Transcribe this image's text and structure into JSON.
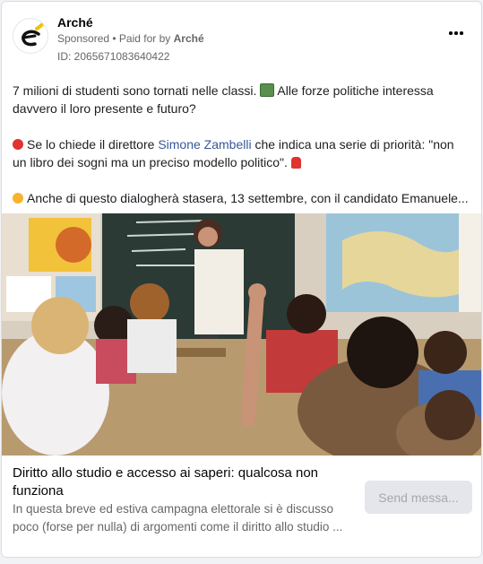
{
  "post": {
    "page_name": "Arché",
    "sponsored": "Sponsored",
    "separator": " • ",
    "paid_for_prefix": "Paid for by ",
    "paid_for_by": "Arché",
    "ad_id": "ID: 2065671083640422",
    "more_icon": "more-options-icon"
  },
  "body": {
    "para1_line1": "7 milioni di studenti sono tornati nelle classi. ",
    "para1_emoji": "classroom-emoji",
    "para1_line1b": " Alle forze politiche interessa",
    "para1_line2": "davvero il loro presente e futuro?",
    "para2_emoji": "red-circle-emoji",
    "para2_pre": "Se lo chiede il direttore ",
    "para2_link": "Simone Zambelli",
    "para2_post": " che indica una serie di priorità: \"non un libro dei sogni ma un preciso modello politico\". ",
    "para2_end_emoji": "backpack-emoji",
    "para3_emoji": "orange-circle-emoji",
    "para3_text": "Anche di questo dialogherà stasera, 13 settembre, con il candidato Emanuele..."
  },
  "link_preview": {
    "headline": "Diritto allo studio e accesso ai saperi: qualcosa non funziona",
    "description_line1": "In questa breve ed estiva campagna elettorale si è discusso",
    "description_line2": "poco (forse per nulla) di argomenti come il diritto allo studio ...",
    "cta_label": "Send messa..."
  },
  "colors": {
    "link": "#385898",
    "muted": "#65676b",
    "cta_bg": "#e4e6eb"
  }
}
